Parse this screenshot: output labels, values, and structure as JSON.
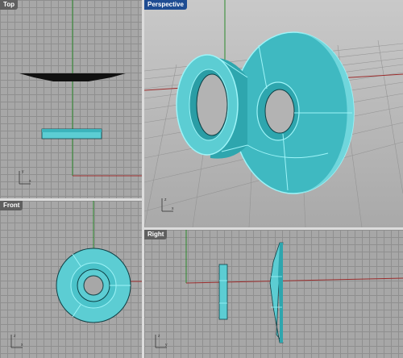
{
  "viewports": {
    "top": {
      "label": "Top"
    },
    "perspective": {
      "label": "Perspective"
    },
    "front": {
      "label": "Front"
    },
    "right": {
      "label": "Right"
    }
  },
  "colors": {
    "object": "#5ccdd3",
    "object_dark": "#2aa6ae",
    "object_edge": "#0d3f44",
    "x_axis": "#9c2c2c",
    "y_axis": "#2b8a2b",
    "active_tab": "#1e4c92",
    "grid": "#8f8f8f"
  },
  "active_viewport": "perspective"
}
